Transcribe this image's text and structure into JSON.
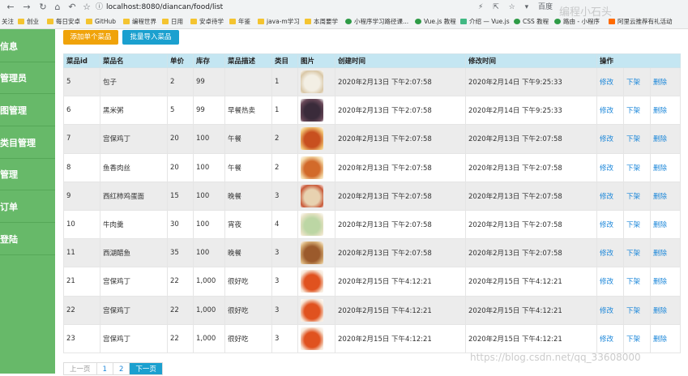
{
  "browser": {
    "url": "localhost:8080/diancan/food/list",
    "search_engine": "百度",
    "bookmarks": [
      {
        "label": "关注",
        "icon": "folder-icon"
      },
      {
        "label": "创业",
        "icon": "folder-icon"
      },
      {
        "label": "每日安卓",
        "icon": "folder-icon"
      },
      {
        "label": "GitHub",
        "icon": "folder-icon"
      },
      {
        "label": "编程世界",
        "icon": "folder-icon"
      },
      {
        "label": "日用",
        "icon": "folder-icon"
      },
      {
        "label": "安卓待学",
        "icon": "folder-icon"
      },
      {
        "label": "年鉴",
        "icon": "folder-icon"
      },
      {
        "label": "java-m学习",
        "icon": "folder-icon"
      },
      {
        "label": "本周要学",
        "icon": "folder-icon"
      },
      {
        "label": "小程序学习路径课...",
        "icon": "miniprogram-icon"
      },
      {
        "label": "Vue.js 教程",
        "icon": "runoob-icon"
      },
      {
        "label": "介绍 — Vue.js",
        "icon": "vue-icon"
      },
      {
        "label": "CSS 教程",
        "icon": "runoob-icon"
      },
      {
        "label": "路由 - 小程序",
        "icon": "miniprogram-icon"
      },
      {
        "label": "阿里云推荐有礼活动",
        "icon": "aliyun-icon"
      }
    ],
    "overlay_text": "编程小石头"
  },
  "sidebar": {
    "items": [
      {
        "label": "信息"
      },
      {
        "label": "管理员"
      },
      {
        "label": "图管理"
      },
      {
        "label": "类目管理"
      },
      {
        "label": "管理"
      },
      {
        "label": "订单"
      },
      {
        "label": "登陆"
      }
    ]
  },
  "toolbar": {
    "add_label": "添加单个菜品",
    "import_label": "批量导入菜品"
  },
  "table": {
    "headers": [
      "菜品id",
      "菜品名",
      "单价",
      "库存",
      "菜品描述",
      "类目",
      "图片",
      "创建时间",
      "修改时间",
      "操作"
    ],
    "action_labels": {
      "edit": "修改",
      "offline": "下架",
      "delete": "删除"
    },
    "rows": [
      {
        "id": "5",
        "name": "包子",
        "price": "2",
        "stock": "99",
        "desc": "",
        "category": "1",
        "image": "baozi",
        "created": "2020年2月13日 下午2:07:58",
        "modified": "2020年2月14日 下午9:25:33"
      },
      {
        "id": "6",
        "name": "黑米粥",
        "price": "5",
        "stock": "99",
        "desc": "早餐热卖",
        "category": "1",
        "image": "porridge",
        "created": "2020年2月13日 下午2:07:58",
        "modified": "2020年2月14日 下午9:25:33"
      },
      {
        "id": "7",
        "name": "宫保鸡丁",
        "price": "20",
        "stock": "100",
        "desc": "午餐",
        "category": "2",
        "image": "kungpao",
        "created": "2020年2月13日 下午2:07:58",
        "modified": "2020年2月13日 下午2:07:58"
      },
      {
        "id": "8",
        "name": "鱼香肉丝",
        "price": "20",
        "stock": "100",
        "desc": "午餐",
        "category": "2",
        "image": "yuxiang",
        "created": "2020年2月13日 下午2:07:58",
        "modified": "2020年2月13日 下午2:07:58"
      },
      {
        "id": "9",
        "name": "西红柿鸡蛋面",
        "price": "15",
        "stock": "100",
        "desc": "晚餐",
        "category": "3",
        "image": "noodles",
        "created": "2020年2月13日 下午2:07:58",
        "modified": "2020年2月13日 下午2:07:58"
      },
      {
        "id": "10",
        "name": "牛肉羹",
        "price": "30",
        "stock": "100",
        "desc": "宵夜",
        "category": "4",
        "image": "soup",
        "created": "2020年2月13日 下午2:07:58",
        "modified": "2020年2月13日 下午2:07:58"
      },
      {
        "id": "11",
        "name": "西湖醋鱼",
        "price": "35",
        "stock": "100",
        "desc": "晚餐",
        "category": "3",
        "image": "fish",
        "created": "2020年2月13日 下午2:07:58",
        "modified": "2020年2月13日 下午2:07:58"
      },
      {
        "id": "21",
        "name": "宫保鸡丁",
        "price": "22",
        "stock": "1,000",
        "desc": "很好吃",
        "category": "3",
        "image": "chicken",
        "created": "2020年2月15日 下午4:12:21",
        "modified": "2020年2月15日 下午4:12:21"
      },
      {
        "id": "22",
        "name": "宫保鸡丁",
        "price": "22",
        "stock": "1,000",
        "desc": "很好吃",
        "category": "3",
        "image": "chicken",
        "created": "2020年2月15日 下午4:12:21",
        "modified": "2020年2月15日 下午4:12:21"
      },
      {
        "id": "23",
        "name": "宫保鸡丁",
        "price": "22",
        "stock": "1,000",
        "desc": "很好吃",
        "category": "3",
        "image": "chicken",
        "created": "2020年2月15日 下午4:12:21",
        "modified": "2020年2月15日 下午4:12:21"
      }
    ]
  },
  "pagination": {
    "prev_label": "上一页",
    "pages": [
      "1",
      "2"
    ],
    "next_label": "下一页"
  },
  "watermark": "https://blog.csdn.net/qq_33608000",
  "colors": {
    "sidebar_bg": "#67b969",
    "header_bg": "#c4e6f2",
    "add_button": "#f0a30a",
    "import_button": "#1ba0cf",
    "link": "#1a86d9"
  }
}
